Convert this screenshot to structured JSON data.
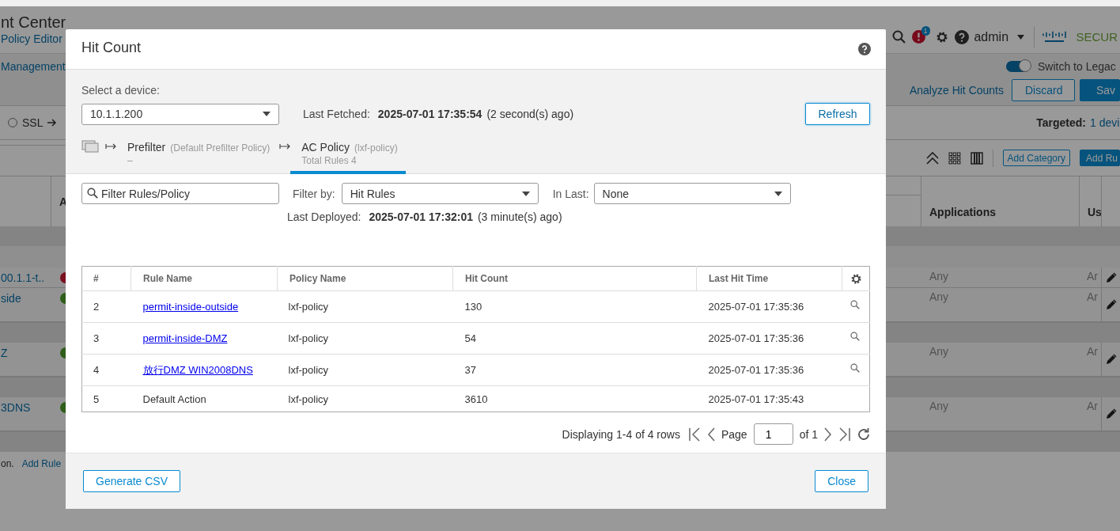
{
  "app_header": {
    "product": "nt Center",
    "page": "Policy Editor",
    "alert_badge": "1",
    "user": "admin",
    "brand": "SECUR"
  },
  "subheader": {
    "section": "Management",
    "legacy_switch": {
      "label": "Switch to Legac",
      "on": true
    }
  },
  "actions": [
    {
      "label": "Analyze Hit Counts",
      "kind": "link"
    },
    {
      "label": "Discard",
      "kind": "outline"
    },
    {
      "label": "Sav",
      "kind": "primary"
    }
  ],
  "policy_bar": {
    "option": {
      "label": "SSL",
      "selected": false
    },
    "targeted_label": "Targeted:",
    "targeted_value": "1 devi"
  },
  "toolbar": [
    {
      "label": "Add Category",
      "kind": "outline"
    },
    {
      "label": "Add Ru",
      "kind": "primary"
    }
  ],
  "rules_table": {
    "columns": [
      "A",
      "Applications",
      "Us"
    ],
    "rows": [
      {
        "kind": "category"
      },
      {
        "kind": "subcategory"
      },
      {
        "kind": "rule",
        "name": "00.1.1-t..",
        "color": "#7a1020",
        "applications": "Any",
        "users": "Ar"
      },
      {
        "kind": "rule",
        "name": "side",
        "color": "#2e5e1a",
        "applications": "Any",
        "users": "Ar"
      },
      {
        "kind": "category"
      },
      {
        "kind": "rule",
        "name": "Z",
        "color": "#2e5e1a",
        "applications": "Any",
        "users": "Ar"
      },
      {
        "kind": "category"
      },
      {
        "kind": "rule",
        "name": "3DNS",
        "color": "#2e5e1a",
        "applications": "Any",
        "users": "Ar"
      },
      {
        "kind": "category"
      }
    ]
  },
  "footer": {
    "text": "on.",
    "link": "Add Rule"
  },
  "dialog": {
    "title": "Hit Count",
    "device_label": "Select a device:",
    "device": "10.1.1.200",
    "fetched_label": "Last Fetched:",
    "fetched_time": "2025-07-01 17:35:54",
    "fetched_ago": "(2 second(s) ago)",
    "refresh": "Refresh",
    "tabs": [
      {
        "name": "Prefilter",
        "policy": "(Default Prefilter Policy)",
        "detail": "–",
        "selected": false
      },
      {
        "name": "AC Policy",
        "policy": "(lxf-policy)",
        "detail": "Total Rules 4",
        "selected": true
      }
    ],
    "search": {
      "placeholder": "Filter Rules/Policy"
    },
    "filter_by": {
      "label": "Filter by:",
      "value": "Hit Rules"
    },
    "in_last": {
      "label": "In Last:",
      "value": "None"
    },
    "deployed_label": "Last Deployed:",
    "deployed_time": "2025-07-01 17:32:01",
    "deployed_ago": "(3 minute(s) ago)",
    "table": {
      "columns": [
        "#",
        "Rule Name",
        "Policy Name",
        "Hit Count",
        "Last Hit Time"
      ],
      "rows": [
        {
          "kind": "rule",
          "index": "2",
          "rule": "permit-inside-outside",
          "policy": "lxf-policy",
          "hits": "130",
          "last_hit": "2025-07-01 17:35:36"
        },
        {
          "kind": "rule",
          "index": "3",
          "rule": "permit-inside-DMZ",
          "policy": "lxf-policy",
          "hits": "54",
          "last_hit": "2025-07-01 17:35:36"
        },
        {
          "kind": "rule",
          "index": "4",
          "rule": "放行DMZ WIN2008DNS",
          "policy": "lxf-policy",
          "hits": "37",
          "last_hit": "2025-07-01 17:35:36"
        },
        {
          "kind": "default",
          "index": "5",
          "rule": "Default Action",
          "policy": "lxf-policy",
          "hits": "3610",
          "last_hit": "2025-07-01 17:35:43"
        }
      ]
    },
    "pager": {
      "summary": "Displaying 1-4 of 4 rows",
      "page_label": "Page",
      "page": "1",
      "of": "of 1"
    },
    "buttons": [
      "Generate CSV",
      "Close"
    ]
  }
}
